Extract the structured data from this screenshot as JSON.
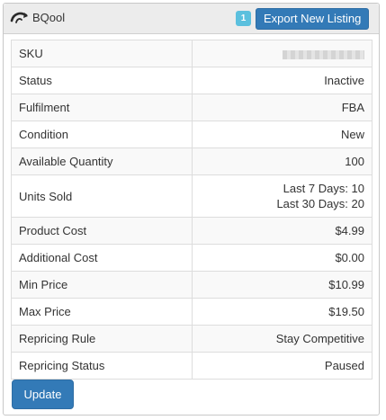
{
  "header": {
    "brand": "BQool",
    "brand_icon": "bqool-logo-icon",
    "badge_count": "1",
    "export_label": "Export New Listing"
  },
  "rows": [
    {
      "label": "SKU",
      "value": ""
    },
    {
      "label": "Status",
      "value": "Inactive"
    },
    {
      "label": "Fulfilment",
      "value": "FBA"
    },
    {
      "label": "Condition",
      "value": "New"
    },
    {
      "label": "Available Quantity",
      "value": "100"
    },
    {
      "label": "Units Sold",
      "value_lines": [
        "Last 7 Days: 10",
        "Last 30 Days: 20"
      ]
    },
    {
      "label": "Product Cost",
      "value": "$4.99"
    },
    {
      "label": "Additional Cost",
      "value": "$0.00"
    },
    {
      "label": "Min Price",
      "value": "$10.99"
    },
    {
      "label": "Max Price",
      "value": "$19.50"
    },
    {
      "label": "Repricing Rule",
      "value": "Stay Competitive"
    },
    {
      "label": "Repricing Status",
      "value": "Paused"
    }
  ],
  "footer": {
    "update_label": "Update"
  },
  "colors": {
    "primary": "#337ab7",
    "badge": "#5bc0de",
    "header_bg": "#ececec"
  }
}
